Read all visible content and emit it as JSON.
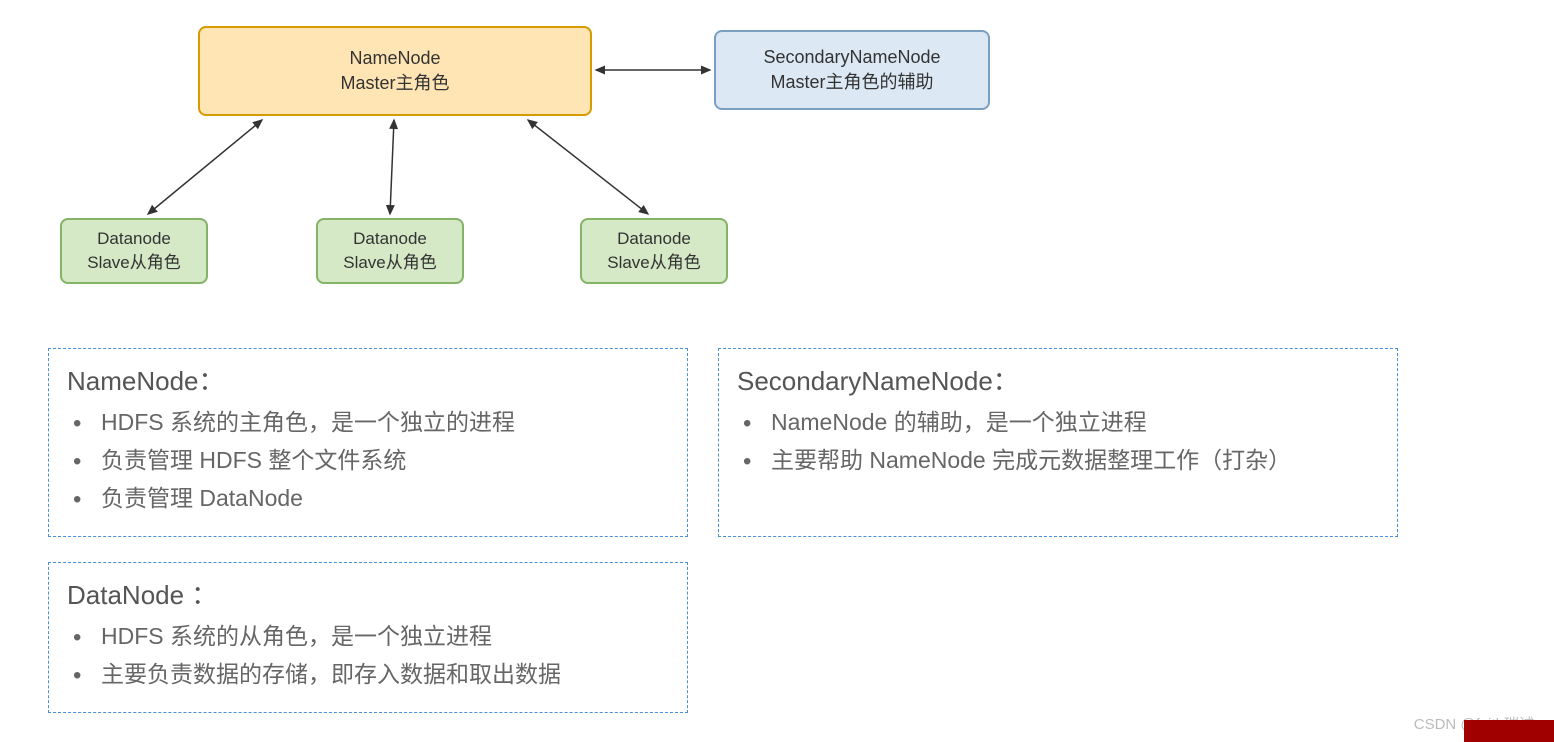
{
  "nodes": {
    "namenode": {
      "title": "NameNode",
      "subtitle": "Master主角色"
    },
    "secondary": {
      "title": "SecondaryNameNode",
      "subtitle": "Master主角色的辅助"
    },
    "datanode": {
      "title": "Datanode",
      "subtitle": "Slave从角色"
    }
  },
  "info": {
    "namenode": {
      "title": "NameNode：",
      "items": [
        "HDFS 系统的主角色，是一个独立的进程",
        "负责管理 HDFS 整个文件系统",
        "负责管理 DataNode"
      ]
    },
    "secondary": {
      "title": "SecondaryNameNode：",
      "items": [
        "NameNode 的辅助，是一个独立进程",
        "主要帮助 NameNode 完成元数据整理工作（打杂）"
      ]
    },
    "datanode": {
      "title": "DataNode ：",
      "items": [
        "HDFS 系统的从角色，是一个独立进程",
        "主要负责数据的存储，即存入数据和取出数据"
      ]
    }
  },
  "watermark": "CSDN @faith瑞诚"
}
